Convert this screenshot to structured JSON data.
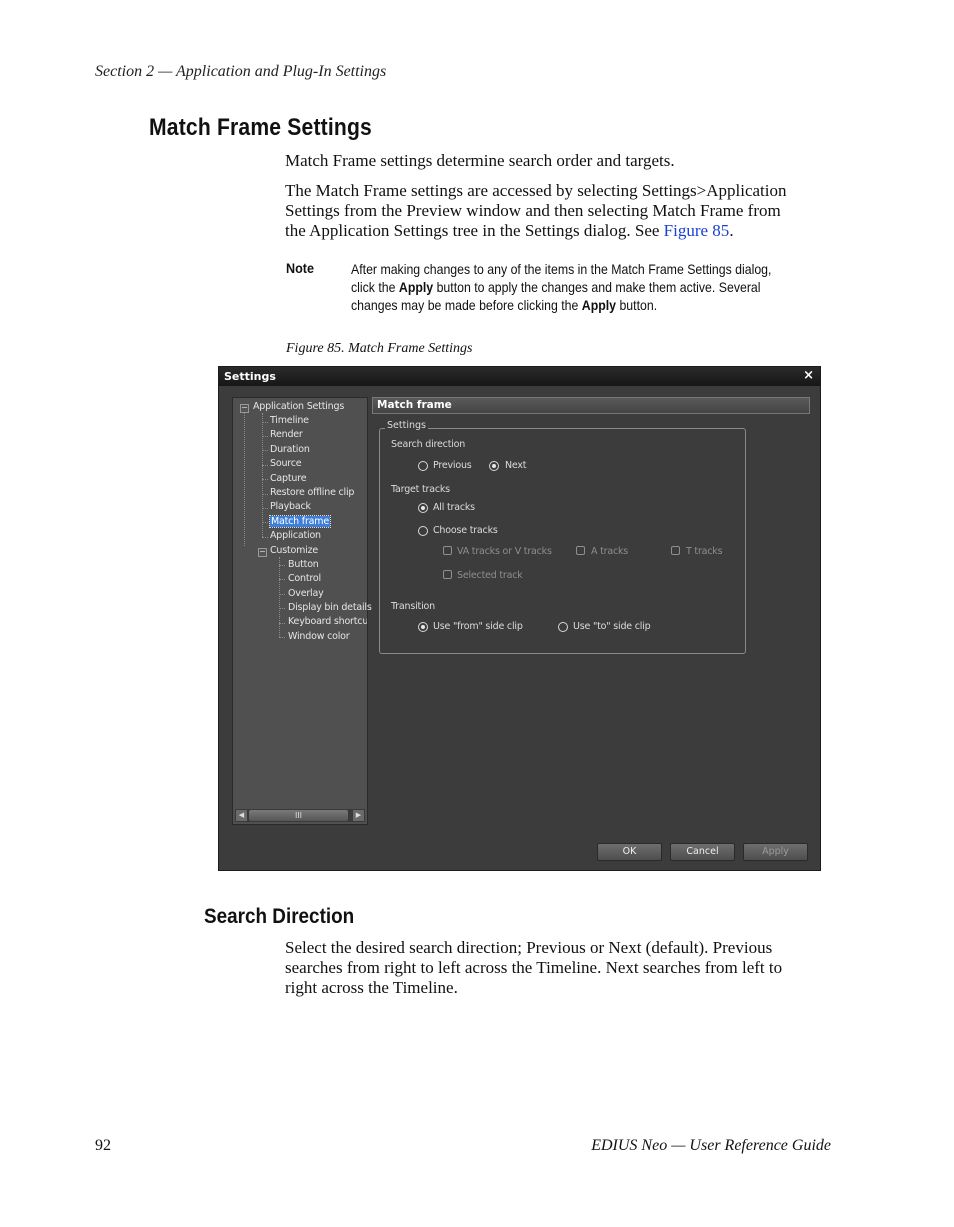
{
  "header": {
    "section": "Section 2 — Application and Plug-In Settings"
  },
  "heading1": "Match Frame Settings",
  "intro": "Match Frame settings determine search order and targets.",
  "access": {
    "line1": "The Match Frame settings are accessed by selecting Settings>Application",
    "line2": "Settings from the Preview window and then selecting Match Frame from",
    "line3_pre": "the Application Settings tree in the Settings dialog. See ",
    "line3_link": "Figure 85",
    "line3_post": "."
  },
  "note": {
    "label": "Note",
    "line1": "After making changes to any of the items in the Match Frame Settings dialog,",
    "line2_pre": "click the ",
    "apply1": "Apply",
    "line2_post": " button to apply the changes and make them active. Several",
    "line3_pre": "changes may be made before clicking the ",
    "apply2": "Apply",
    "line3_post": " button."
  },
  "caption": "Figure 85.  Match Frame Settings",
  "dialog": {
    "title": "Settings",
    "close_glyph": "×",
    "tree": {
      "root": "Application Settings",
      "items": [
        "Timeline",
        "Render",
        "Duration",
        "Source",
        "Capture",
        "Restore offline clip",
        "Playback",
        "Match frame",
        "Application"
      ],
      "customize": "Customize",
      "custom_items": [
        "Button",
        "Control",
        "Overlay",
        "Display bin details",
        "Keyboard shortcut",
        "Window color"
      ],
      "toggle_glyph": "−",
      "scroll_left": "◀",
      "scroll_right": "▶",
      "scroll_thumb": "III"
    },
    "panel_title": "Match frame",
    "group_title": "Settings",
    "search_direction": {
      "label": "Search direction",
      "previous": "Previous",
      "next": "Next",
      "selected": "Next"
    },
    "target_tracks": {
      "label": "Target tracks",
      "all": "All tracks",
      "choose": "Choose tracks",
      "selected": "All tracks",
      "va": "VA tracks or V tracks",
      "a": "A tracks",
      "t": "T tracks",
      "sel_track": "Selected track"
    },
    "transition": {
      "label": "Transition",
      "from": "Use \"from\" side clip",
      "to": "Use \"to\" side clip",
      "selected": "Use \"from\" side clip"
    },
    "buttons": {
      "ok": "OK",
      "cancel": "Cancel",
      "apply": "Apply"
    }
  },
  "heading2": "Search Direction",
  "search_para": {
    "line1": "Select the desired search direction; Previous or Next (default). Previous",
    "line2": "searches from right to left across the Timeline. Next searches from left to",
    "line3": "right across the Timeline."
  },
  "footer": {
    "page": "92",
    "guide": "EDIUS Neo  —  User Reference Guide"
  },
  "colors": {
    "link": "#1a3fd1",
    "dialog_bg": "#3c3c3c",
    "selection": "#3d7fd9"
  }
}
